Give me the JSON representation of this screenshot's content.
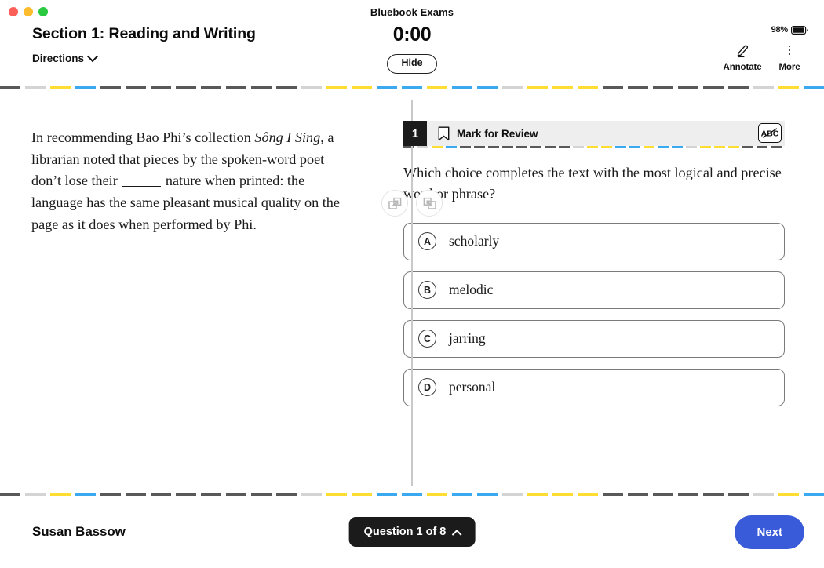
{
  "window": {
    "title": "Bluebook Exams",
    "traffic_lights": [
      "close-red",
      "minimize-yellow",
      "maximize-green"
    ]
  },
  "header": {
    "section_title": "Section 1: Reading and Writing",
    "directions_label": "Directions",
    "directions_icon": "chevron-down-icon",
    "timer": "0:00",
    "hide_label": "Hide",
    "battery_percent": "98%",
    "battery_icon": "battery-icon",
    "tools": [
      {
        "label": "Annotate",
        "icon": "pencil-highlighter-icon"
      },
      {
        "label": "More",
        "icon": "vertical-dots-icon"
      }
    ]
  },
  "divider": {
    "colors": {
      "dark": "#595959",
      "light": "#d4d4d4",
      "yellow": "#FFDD33",
      "blue": "#3BA9F0"
    },
    "pattern": [
      "dark",
      "light",
      "yellow",
      "blue",
      "dark",
      "dark",
      "dark",
      "dark",
      "dark",
      "dark",
      "dark",
      "dark",
      "light",
      "yellow",
      "yellow",
      "blue",
      "blue",
      "yellow",
      "blue",
      "blue",
      "light",
      "yellow",
      "yellow",
      "yellow",
      "dark",
      "dark",
      "dark",
      "dark",
      "dark",
      "dark",
      "light",
      "yellow",
      "blue",
      "yellow",
      "dark",
      "dark",
      "dark",
      "dark",
      "dark",
      "light",
      "yellow",
      "blue",
      "blue",
      "yellow",
      "dark",
      "dark",
      "dark",
      "dark",
      "light",
      "yellow",
      "yellow",
      "blue",
      "dark",
      "dark",
      "dark",
      "dark",
      "dark",
      "light",
      "yellow",
      "blue",
      "yellow",
      "blue",
      "light",
      "yellow",
      "dark",
      "dark",
      "dark",
      "dark",
      "dark",
      "dark",
      "light",
      "yellow",
      "blue",
      "yellow",
      "dark",
      "dark",
      "dark",
      "dark",
      "dark",
      "light",
      "yellow",
      "blue",
      "blue",
      "yellow",
      "dark",
      "dark",
      "dark",
      "dark"
    ]
  },
  "split_controls": [
    {
      "name": "expand-right-pane-button",
      "icon": "expand-arrow-icon"
    },
    {
      "name": "collapse-right-pane-button",
      "icon": "collapse-arrow-icon"
    }
  ],
  "passage": {
    "before_title": "In recommending Bao Phi’s collection ",
    "title": "Sông I Sing",
    "after_title": ", a librarian noted that pieces by the spoken-word poet don’t lose their ",
    "blank": "______",
    "after_blank": " nature when printed: the language has the same pleasant musical quality on the page as it does when performed by Phi."
  },
  "question": {
    "number": "1",
    "mark_for_review_label": "Mark for Review",
    "bookmark_icon": "bookmark-icon",
    "cross_out_icon": "abc-strikethrough-icon",
    "prompt": "Which choice completes the text with the most logical and precise word or phrase?",
    "choices": [
      {
        "letter": "A",
        "text": "scholarly"
      },
      {
        "letter": "B",
        "text": "melodic"
      },
      {
        "letter": "C",
        "text": "jarring"
      },
      {
        "letter": "D",
        "text": "personal"
      }
    ]
  },
  "footer": {
    "user_name": "Susan Bassow",
    "question_nav_label": "Question 1 of 8",
    "question_nav_icon": "chevron-up-icon",
    "next_label": "Next",
    "next_color": "#3A5BD9"
  }
}
